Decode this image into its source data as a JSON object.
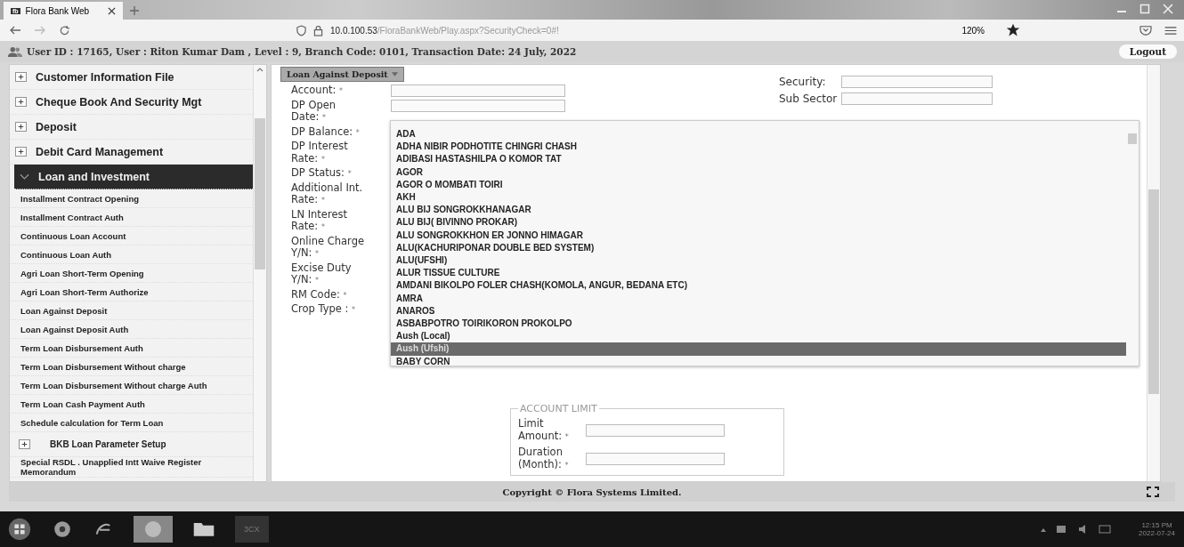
{
  "browser": {
    "tab_icon_text": "fb",
    "tab_title": "Flora Bank Web",
    "address_host": "10.0.100.53",
    "address_path": "/FloraBankWeb/Play.aspx?SecurityCheck=0#!",
    "zoom": "120%"
  },
  "header": {
    "user_info": "User ID : 17165, User : Riton Kumar Dam , Level : 9, Branch Code: 0101, Transaction Date: 24 July, 2022",
    "logout": "Logout"
  },
  "sidebar": {
    "items": [
      {
        "label": "Customer Information File",
        "kind": "group",
        "expanded": false,
        "selected": false
      },
      {
        "label": "Cheque Book And Security Mgt",
        "kind": "group",
        "expanded": false,
        "selected": false
      },
      {
        "label": "Deposit",
        "kind": "group",
        "expanded": false,
        "selected": false
      },
      {
        "label": "Debit Card Management",
        "kind": "group",
        "expanded": false,
        "selected": false
      },
      {
        "label": "Loan and Investment",
        "kind": "group",
        "expanded": true,
        "selected": true,
        "children": [
          {
            "label": "Installment Contract Opening",
            "kind": "link",
            "selected": false
          },
          {
            "label": "Installment Contract Auth",
            "kind": "link",
            "selected": false
          },
          {
            "label": "Continuous Loan Account",
            "kind": "link",
            "selected": false
          },
          {
            "label": "Continuous Loan Auth",
            "kind": "link",
            "selected": false
          },
          {
            "label": "Agri Loan  Short-Term Opening",
            "kind": "link",
            "selected": false
          },
          {
            "label": "Agri Loan  Short-Term Authorize",
            "kind": "link",
            "selected": false
          },
          {
            "label": "Loan Against Deposit",
            "kind": "link",
            "selected": false
          },
          {
            "label": "Loan Against Deposit Auth",
            "kind": "link",
            "selected": false
          },
          {
            "label": "Term Loan Disbursement Auth",
            "kind": "link",
            "selected": false
          },
          {
            "label": "Term Loan Disbursement Without charge",
            "kind": "link",
            "selected": false
          },
          {
            "label": "Term Loan Disbursement Without charge Auth",
            "kind": "link",
            "selected": false
          },
          {
            "label": "Term Loan Cash Payment Auth",
            "kind": "link",
            "selected": false
          },
          {
            "label": "Schedule calculation for Term Loan",
            "kind": "link",
            "selected": false
          },
          {
            "label": "BKB Loan Parameter Setup",
            "kind": "group",
            "expanded": false,
            "selected": false
          },
          {
            "label": "Special RSDL . Unapplied Intt Waive Register Memorandum",
            "kind": "link",
            "selected": false
          }
        ]
      }
    ]
  },
  "module_menu": {
    "label": "Loan Against Deposit"
  },
  "form": {
    "left_fields": [
      {
        "label": "Account:",
        "required_mark": "*",
        "kind": "input"
      },
      {
        "label": "DP Open Date:",
        "required_mark": "*",
        "kind": "input"
      },
      {
        "label": "DP Balance:",
        "required_mark": "*",
        "kind": "hidden"
      },
      {
        "label": "DP Interest Rate:",
        "required_mark": "*",
        "kind": "hidden"
      },
      {
        "label": "DP Status:",
        "required_mark": "*",
        "kind": "hidden"
      },
      {
        "label": "Additional Int. Rate:",
        "required_mark": "*",
        "kind": "hidden"
      },
      {
        "label": "LN Interest Rate:",
        "required_mark": "*",
        "kind": "hidden"
      },
      {
        "label": "Online Charge Y/N:",
        "required_mark": "*",
        "kind": "hidden"
      },
      {
        "label": "Excise Duty Y/N:",
        "required_mark": "*",
        "kind": "hidden"
      },
      {
        "label": "RM Code:",
        "required_mark": "*",
        "kind": "hidden"
      },
      {
        "label": "Crop Type :",
        "required_mark": "*",
        "kind": "select"
      }
    ],
    "right_fields": [
      {
        "label": "Security:",
        "kind": "input"
      },
      {
        "label": "Sub Sector",
        "kind": "input"
      }
    ],
    "dropdown_options": [
      {
        "label": "ADA",
        "selected": false
      },
      {
        "label": "ADHA NIBIR PODHOTITE CHINGRI CHASH",
        "selected": false
      },
      {
        "label": "ADIBASI HASTASHILPA O KOMOR TAT",
        "selected": false
      },
      {
        "label": "AGOR",
        "selected": false
      },
      {
        "label": "AGOR O MOMBATI TOIRI",
        "selected": false
      },
      {
        "label": "AKH",
        "selected": false
      },
      {
        "label": "ALU BIJ SONGROKKHANAGAR",
        "selected": false
      },
      {
        "label": "ALU BIJ( BIVINNO PROKAR)",
        "selected": false
      },
      {
        "label": "ALU SONGROKKHON ER JONNO HIMAGAR",
        "selected": false
      },
      {
        "label": "ALU(KACHURIPONAR DOUBLE BED SYSTEM)",
        "selected": false
      },
      {
        "label": "ALU(UFSHI)",
        "selected": false
      },
      {
        "label": "ALUR TISSUE CULTURE",
        "selected": false
      },
      {
        "label": "AMDANI BIKOLPO FOLER CHASH(KOMOLA, ANGUR, BEDANA ETC)",
        "selected": false
      },
      {
        "label": "AMRA",
        "selected": false
      },
      {
        "label": "ANAROS",
        "selected": false
      },
      {
        "label": "ASBABPOTRO TOIRIKORON PROKOLPO",
        "selected": false
      },
      {
        "label": "Aush (Local)",
        "selected": false
      },
      {
        "label": "Aush (Ufshi)",
        "selected": true
      },
      {
        "label": "BABY CORN",
        "selected": false
      }
    ],
    "account_limit": {
      "legend": "ACCOUNT LIMIT",
      "fields": [
        {
          "label": "Limit Amount:",
          "required_mark": "*"
        },
        {
          "label": "Duration (Month):",
          "required_mark": "*"
        }
      ]
    }
  },
  "footer": {
    "copyright": "Copyright © Flora Systems Limited."
  },
  "taskbar": {
    "app_label": "3CX",
    "time": "12:15 PM",
    "date": "2022-07-24"
  }
}
